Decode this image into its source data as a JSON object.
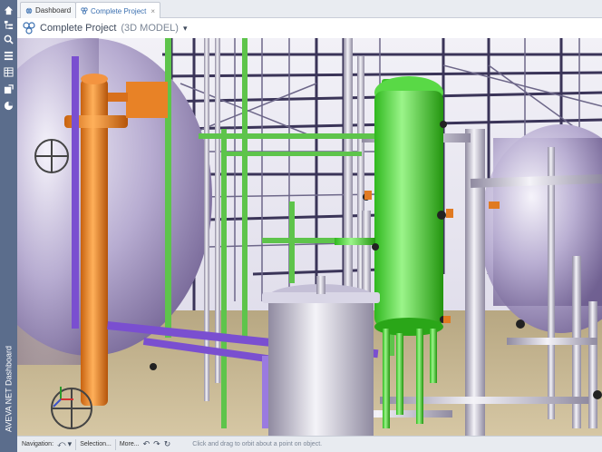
{
  "app": {
    "rail_label": "AVEVA NET Dashboard",
    "accent": "#5b6d8c"
  },
  "rail_icons": [
    "home-icon",
    "hierarchy-icon",
    "search-icon",
    "list-icon",
    "table-icon",
    "document-icon",
    "export-icon",
    "pie-chart-icon"
  ],
  "tabs": [
    {
      "label": "Dashboard",
      "icon": "globe-icon",
      "active": false
    },
    {
      "label": "Complete Project",
      "icon": "model-icon",
      "active": true,
      "close": "×"
    }
  ],
  "title": {
    "name": "Complete Project",
    "subtitle": "(3D MODEL)",
    "dropdown": "▾"
  },
  "bottombar": {
    "navigation_label": "Navigation:",
    "selection_label": "Selection...",
    "more_label": "More...",
    "hint": "Click and drag to orbit about a point on object."
  }
}
